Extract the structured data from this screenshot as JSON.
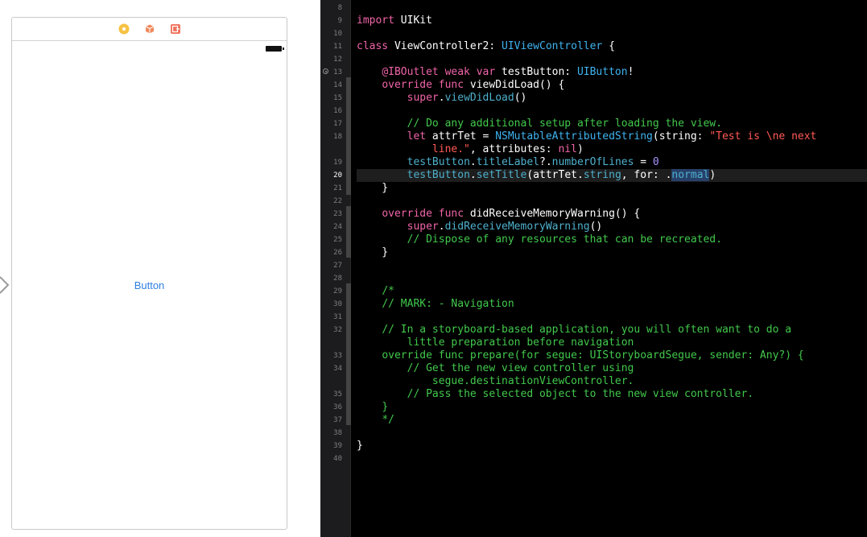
{
  "storyboard": {
    "button_label": "Button",
    "dock_icons": [
      {
        "name": "view-controller-icon",
        "color": "#f5c242"
      },
      {
        "name": "first-responder-icon",
        "color": "#f08a5d"
      },
      {
        "name": "exit-icon",
        "color": "#f0735d"
      }
    ]
  },
  "editor": {
    "current_line": 20,
    "line_numbers": [
      "8",
      "9",
      "10",
      "11",
      "12",
      "13",
      "14",
      "15",
      "16",
      "17",
      "18",
      "",
      "19",
      "20",
      "21",
      "22",
      "23",
      "24",
      "25",
      "26",
      "27",
      "28",
      "29",
      "30",
      "31",
      "32",
      "",
      "33",
      "34",
      "",
      "35",
      "36",
      "37",
      "38",
      "39",
      "40"
    ],
    "lines": [
      [],
      [
        [
          "kw",
          "import"
        ],
        [
          "pl",
          " UIKit"
        ]
      ],
      [],
      [
        [
          "kw",
          "class"
        ],
        [
          "pl",
          " ViewController2: "
        ],
        [
          "ty",
          "UIViewController"
        ],
        [
          "pl",
          " {"
        ]
      ],
      [],
      [
        [
          "pl",
          "    "
        ],
        [
          "kw",
          "@IBOutlet weak var"
        ],
        [
          "pl",
          " testButton: "
        ],
        [
          "ty",
          "UIButton"
        ],
        [
          "pl",
          "!"
        ]
      ],
      [
        [
          "pl",
          "    "
        ],
        [
          "kw",
          "override func"
        ],
        [
          "pl",
          " viewDidLoad() {"
        ]
      ],
      [
        [
          "pl",
          "        "
        ],
        [
          "kw",
          "super"
        ],
        [
          "pl",
          "."
        ],
        [
          "fn",
          "viewDidLoad"
        ],
        [
          "pl",
          "()"
        ]
      ],
      [],
      [
        [
          "pl",
          "        "
        ],
        [
          "cm",
          "// Do any additional setup after loading the view."
        ]
      ],
      [
        [
          "pl",
          "        "
        ],
        [
          "kw",
          "let"
        ],
        [
          "pl",
          " attrTet = "
        ],
        [
          "ty",
          "NSMutableAttributedString"
        ],
        [
          "pl",
          "(string: "
        ],
        [
          "st",
          "\"Test is \\ne next"
        ]
      ],
      [
        [
          "pl",
          "            "
        ],
        [
          "st",
          "line.\""
        ],
        [
          "pl",
          ", attributes: "
        ],
        [
          "kw",
          "nil"
        ],
        [
          "pl",
          ")"
        ]
      ],
      [
        [
          "pl",
          "        "
        ],
        [
          "fn",
          "testButton"
        ],
        [
          "pl",
          "."
        ],
        [
          "fn",
          "titleLabel"
        ],
        [
          "pl",
          "?."
        ],
        [
          "fn",
          "numberOfLines"
        ],
        [
          "pl",
          " = "
        ],
        [
          "nm",
          "0"
        ]
      ],
      [
        [
          "pl",
          "        "
        ],
        [
          "fn",
          "testButton"
        ],
        [
          "pl",
          "."
        ],
        [
          "fn",
          "setTitle"
        ],
        [
          "pl",
          "(attrTet."
        ],
        [
          "fn",
          "string"
        ],
        [
          "pl",
          ", for: ."
        ],
        [
          "sel",
          "normal"
        ],
        [
          "pl",
          ")"
        ]
      ],
      [
        [
          "pl",
          "    }"
        ]
      ],
      [],
      [
        [
          "pl",
          "    "
        ],
        [
          "kw",
          "override func"
        ],
        [
          "pl",
          " didReceiveMemoryWarning() {"
        ]
      ],
      [
        [
          "pl",
          "        "
        ],
        [
          "kw",
          "super"
        ],
        [
          "pl",
          "."
        ],
        [
          "fn",
          "didReceiveMemoryWarning"
        ],
        [
          "pl",
          "()"
        ]
      ],
      [
        [
          "pl",
          "        "
        ],
        [
          "cm",
          "// Dispose of any resources that can be recreated."
        ]
      ],
      [
        [
          "pl",
          "    }"
        ]
      ],
      [],
      [],
      [
        [
          "pl",
          "    "
        ],
        [
          "cm",
          "/*"
        ]
      ],
      [
        [
          "pl",
          "    "
        ],
        [
          "cm",
          "// MARK: - Navigation"
        ]
      ],
      [],
      [
        [
          "pl",
          "    "
        ],
        [
          "cm",
          "// In a storyboard-based application, you will often want to do a"
        ]
      ],
      [
        [
          "pl",
          "        "
        ],
        [
          "cm",
          "little preparation before navigation"
        ]
      ],
      [
        [
          "pl",
          "    "
        ],
        [
          "cm",
          "override func prepare(for segue: UIStoryboardSegue, sender: Any?) {"
        ]
      ],
      [
        [
          "pl",
          "        "
        ],
        [
          "cm",
          "// Get the new view controller using"
        ]
      ],
      [
        [
          "pl",
          "            "
        ],
        [
          "cm",
          "segue.destinationViewController."
        ]
      ],
      [
        [
          "pl",
          "        "
        ],
        [
          "cm",
          "// Pass the selected object to the new view controller."
        ]
      ],
      [
        [
          "pl",
          "    "
        ],
        [
          "cm",
          "}"
        ]
      ],
      [
        [
          "pl",
          "    "
        ],
        [
          "cm",
          "*/"
        ]
      ],
      [],
      [
        [
          "pl",
          "}"
        ]
      ],
      []
    ]
  }
}
